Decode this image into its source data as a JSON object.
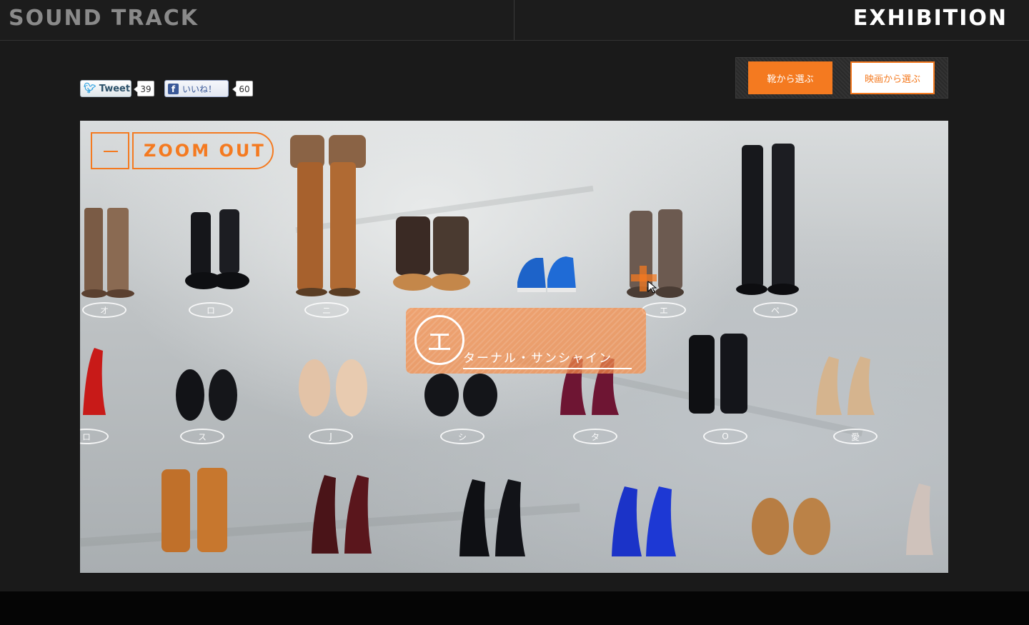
{
  "header": {
    "brand": "SOUND TRACK",
    "section": "EXHIBITION"
  },
  "social": {
    "tweet_label": "Tweet",
    "tweet_count": "39",
    "like_label": "いいね！",
    "like_count": "60"
  },
  "selector": {
    "by_shoes": "靴から選ぶ",
    "by_movie": "映画から選ぶ"
  },
  "stage": {
    "zoom_out_label": "ZOOM OUT",
    "tooltip_kana": "エ",
    "tooltip_title": "ターナル・サンシャイン",
    "floor_labels_row1": [
      "オ",
      "ロ",
      "ニ",
      "",
      "",
      "エ",
      "ペ"
    ],
    "floor_labels_row2": [
      "ロ",
      "ス",
      "J",
      "シ",
      "タ",
      "O",
      "愛"
    ]
  },
  "colors": {
    "accent": "#f47a20",
    "background": "#1a1a1a"
  }
}
